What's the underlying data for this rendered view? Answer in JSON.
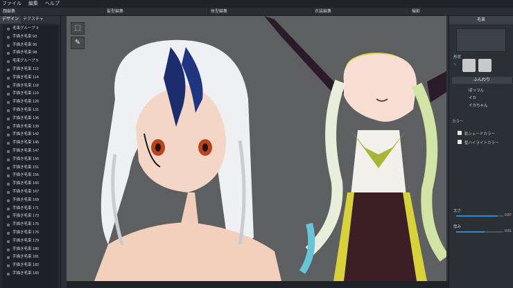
{
  "menu": {
    "file": "ファイル",
    "edit": "編集",
    "help": "ヘルプ"
  },
  "subtabs": [
    "顔編集",
    "髪型編集",
    "体型編集",
    "衣装編集",
    "撮影"
  ],
  "left": {
    "tab_design": "デザイン",
    "tab_texture": "テクスチャ",
    "items": [
      "毛束グループ 3",
      "手描き毛束 93",
      "手描き毛束 96",
      "手描き毛束 98",
      "毛束グループ 5",
      "手描き毛束 112",
      "手描き毛束 114",
      "手描き毛束 118",
      "手描き毛束 119",
      "手描き毛束 120",
      "手描き毛束 131",
      "手描き毛束 136",
      "手描き毛束 139",
      "手描き毛束 142",
      "手描き毛束 145",
      "手描き毛束 147",
      "手描き毛束 150",
      "手描き毛束 151",
      "手描き毛束 155",
      "手描き毛束 160",
      "手描き毛束 167",
      "手描き毛束 169",
      "手描き毛束 171",
      "手描き毛束 173",
      "手描き毛束 175",
      "手描き毛束 176",
      "手描き毛束 179",
      "手描き毛束 180",
      "手描き毛束 181",
      "手描き毛束 182",
      "手描き毛束 183"
    ]
  },
  "tools": {
    "select_icon": "select-icon",
    "pen_icon": "pen-icon"
  },
  "right": {
    "title": "毛束",
    "shape_label": "形状",
    "fuwari": "ふんわり",
    "opt1": "ぱっつん",
    "opt2": "イカ",
    "opt3": "イカちゃん",
    "color_label": "カラー",
    "shade_label": "影シェードカラー",
    "highlight_label": "髪ハイライトカラー",
    "thickness_label": "太さ",
    "thickness_value": "0.87",
    "layer_label": "厚み",
    "layer_value": "0.61"
  },
  "colors": {
    "accent": "#2d8bd6",
    "hair_blue": "#1c2d6e",
    "outfit_yellow": "#d8d23a"
  }
}
